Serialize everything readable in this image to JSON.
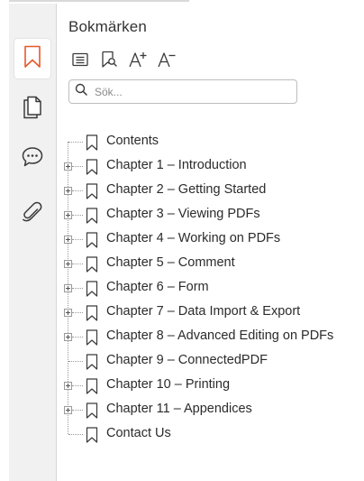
{
  "panel": {
    "title": "Bokmärken"
  },
  "search": {
    "placeholder": "Sök..."
  },
  "sidebar": {
    "items": [
      {
        "name": "bookmarks",
        "icon": "bookmark-icon",
        "active": true
      },
      {
        "name": "pages",
        "icon": "pages-icon",
        "active": false
      },
      {
        "name": "comments",
        "icon": "comment-icon",
        "active": false
      },
      {
        "name": "attachments",
        "icon": "paperclip-icon",
        "active": false
      }
    ]
  },
  "toolbar": {
    "items": [
      {
        "name": "expand-all",
        "icon": "list-icon"
      },
      {
        "name": "find-current-bookmark",
        "icon": "bookmark-search-icon"
      },
      {
        "name": "increase-text-size",
        "icon": "font-increase-icon"
      },
      {
        "name": "decrease-text-size",
        "icon": "font-decrease-icon"
      }
    ]
  },
  "bookmarks": [
    {
      "label": "Contents",
      "expandable": false
    },
    {
      "label": "Chapter 1 – Introduction",
      "expandable": true
    },
    {
      "label": "Chapter 2 – Getting Started",
      "expandable": true
    },
    {
      "label": "Chapter 3 – Viewing PDFs",
      "expandable": true
    },
    {
      "label": "Chapter 4 – Working on PDFs",
      "expandable": true
    },
    {
      "label": "Chapter 5 – Comment",
      "expandable": true
    },
    {
      "label": "Chapter 6 – Form",
      "expandable": true
    },
    {
      "label": "Chapter 7 – Data Import & Export",
      "expandable": true
    },
    {
      "label": "Chapter 8 – Advanced Editing on PDFs",
      "expandable": true
    },
    {
      "label": "Chapter 9 – ConnectedPDF",
      "expandable": false
    },
    {
      "label": "Chapter 10 – Printing",
      "expandable": true
    },
    {
      "label": "Chapter 11 – Appendices",
      "expandable": true
    },
    {
      "label": "Contact Us",
      "expandable": false
    }
  ],
  "colors": {
    "accent": "#e8572a",
    "icon": "#3a3a3a",
    "sidebar_bg": "#f1f1f1"
  }
}
